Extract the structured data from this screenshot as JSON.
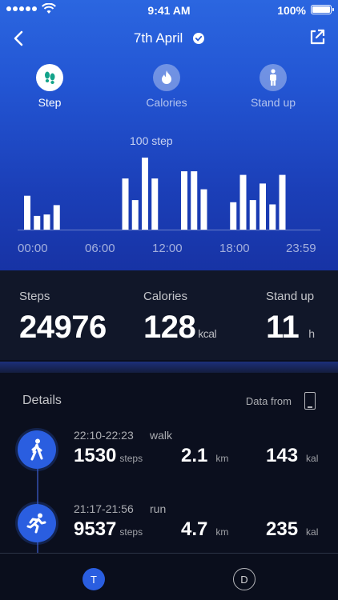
{
  "status_bar": {
    "time": "9:41 AM",
    "battery": "100%"
  },
  "header": {
    "date": "7th April"
  },
  "tabs": [
    {
      "label": "Step",
      "icon": "footprints-icon",
      "active": true
    },
    {
      "label": "Calories",
      "icon": "flame-icon",
      "active": false
    },
    {
      "label": "Stand up",
      "icon": "person-standing-icon",
      "active": false
    }
  ],
  "chart_data": {
    "type": "bar",
    "annotation": "100 step",
    "xticks": [
      "00:00",
      "06:00",
      "12:00",
      "18:00",
      "23:59"
    ],
    "y_max": 100,
    "bar_color": "#ffffff",
    "values": [
      47,
      19,
      21,
      34,
      0,
      0,
      0,
      0,
      0,
      0,
      71,
      41,
      100,
      71,
      0,
      0,
      81,
      81,
      56,
      0,
      0,
      38,
      76,
      41,
      64,
      35,
      76
    ]
  },
  "summary": {
    "steps": {
      "title": "Steps",
      "value": "24976"
    },
    "calories": {
      "title": "Calories",
      "value": "128",
      "unit": "kcal"
    },
    "stand": {
      "title": "Stand up",
      "value": "11",
      "unit": "h"
    }
  },
  "details": {
    "title": "Details",
    "data_from": "Data from",
    "activities": [
      {
        "range": "22:10-22:23",
        "type": "walk",
        "steps": "1530",
        "steps_unit": "steps",
        "distance": "2.1",
        "distance_unit": "km",
        "calories": "143",
        "calories_unit": "kal",
        "icon": "walking-person-icon"
      },
      {
        "range": "21:17-21:56",
        "type": "run",
        "steps": "9537",
        "steps_unit": "steps",
        "distance": "4.7",
        "distance_unit": "km",
        "calories": "235",
        "calories_unit": "kal",
        "icon": "running-person-icon"
      }
    ]
  },
  "bottom_bar": {
    "left": "T",
    "right": "D"
  },
  "colors": {
    "accent": "#2a5ee0",
    "hero_top": "#2b66e0",
    "hero_bottom": "#1733a5",
    "background": "#0a0f1d"
  }
}
